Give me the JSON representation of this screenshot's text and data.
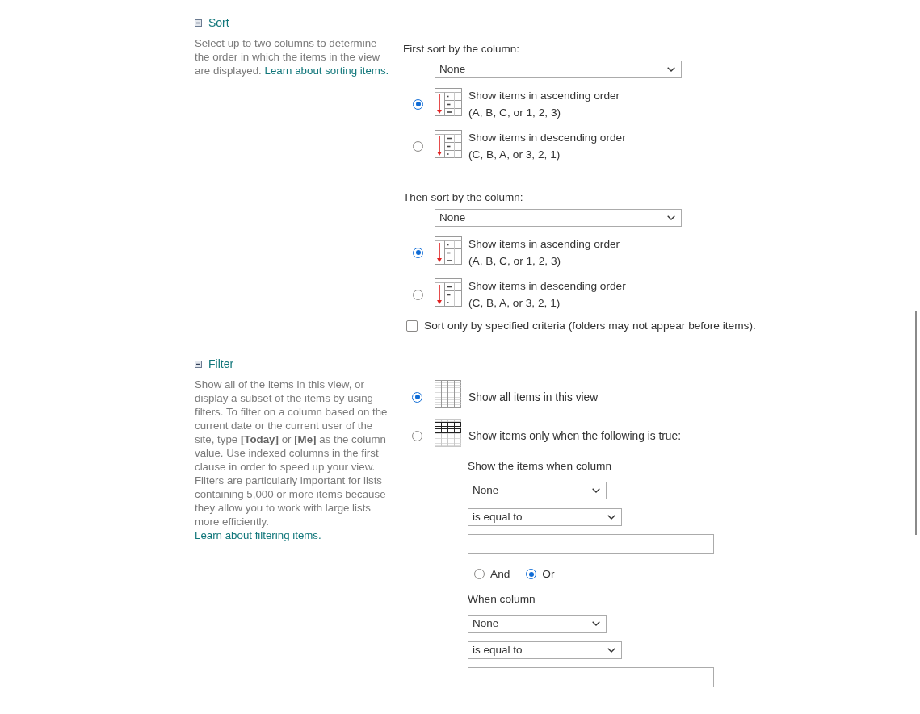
{
  "sort": {
    "title": "Sort",
    "expanded": true,
    "description": "Select up to two columns to determine the order in which the items in the view are displayed.",
    "link": "Learn about sorting items.",
    "levels": [
      {
        "label": "First sort by the column:",
        "column": "None",
        "options": [
          {
            "kind": "ascending",
            "label": "Show items in ascending order",
            "detail": "(A, B, C, or 1, 2, 3)",
            "selected": true
          },
          {
            "kind": "descending",
            "label": "Show items in descending order",
            "detail": "(C, B, A, or 3, 2, 1)",
            "selected": false
          }
        ]
      },
      {
        "label": "Then sort by the column:",
        "column": "None",
        "options": [
          {
            "kind": "ascending",
            "label": "Show items in ascending order",
            "detail": "(A, B, C, or 1, 2, 3)",
            "selected": true
          },
          {
            "kind": "descending",
            "label": "Show items in descending order",
            "detail": "(C, B, A, or 3, 2, 1)",
            "selected": false
          }
        ]
      }
    ],
    "checkbox": {
      "label": "Sort only by specified criteria (folders may not appear before items).",
      "checked": false
    }
  },
  "filter": {
    "title": "Filter",
    "expanded": true,
    "description": "Show all of the items in this view, or display a subset of the items by using filters. To filter on a column based on the current date or the current user of the site, type **[Today]** or **[Me]** as the column value. Use indexed columns in the first clause in order to speed up your view. Filters are particularly important for lists containing 5,000 or more items because they allow you to work with large lists more efficiently.",
    "link": "Learn about filtering items.",
    "options": [
      {
        "kind": "all",
        "label": "Show all items in this view",
        "selected": true
      },
      {
        "kind": "conditional",
        "label": "Show items only when the following is true:",
        "selected": false
      }
    ],
    "conditions": [
      {
        "label": "Show the items when column",
        "column": "None",
        "operator": "is equal to"
      },
      {
        "label": "When column",
        "column": "None",
        "operator": "is equal to"
      }
    ],
    "connectors": [
      {
        "label": "And",
        "selected": false
      },
      {
        "label": "Or",
        "selected": true
      }
    ]
  }
}
